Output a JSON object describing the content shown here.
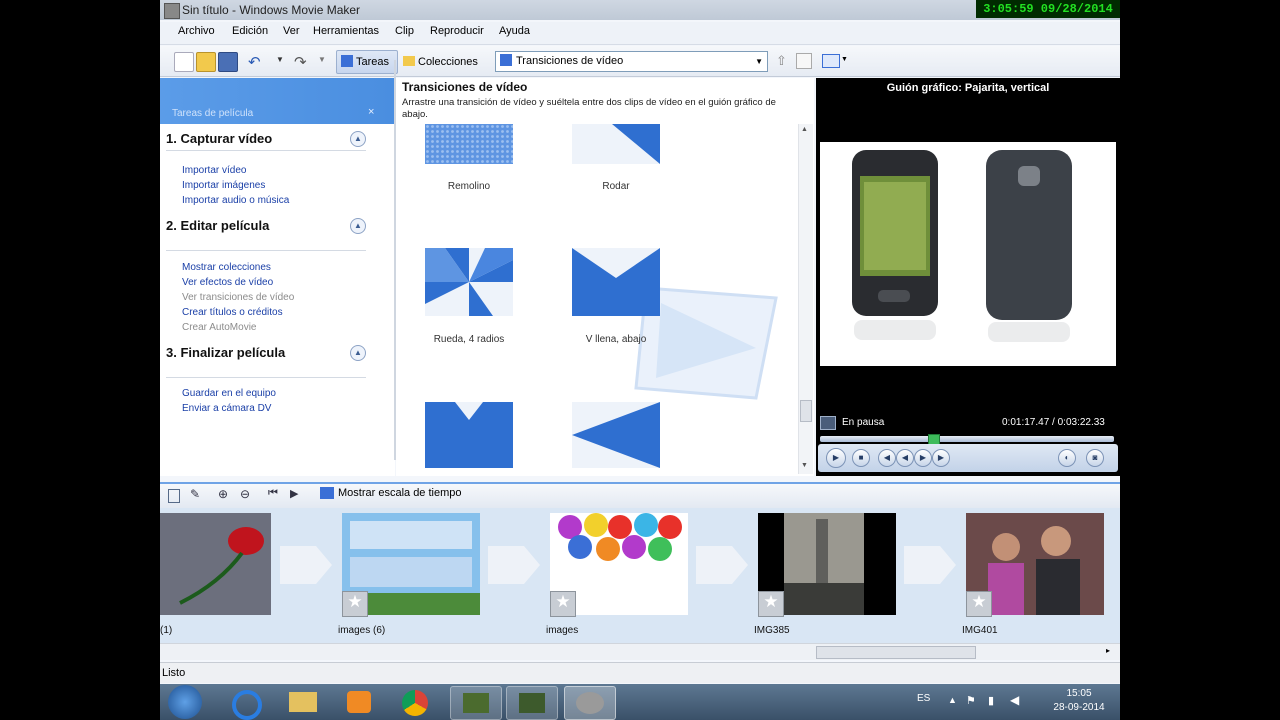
{
  "window": {
    "title": "Sin título - Windows Movie Maker"
  },
  "clock": "3:05:59  09/28/2014",
  "menu": [
    "Archivo",
    "Edición",
    "Ver",
    "Herramientas",
    "Clip",
    "Reproducir",
    "Ayuda"
  ],
  "toolbar": {
    "tasks_label": "Tareas",
    "collections_label": "Colecciones",
    "combo_value": "Transiciones de vídeo"
  },
  "tasks_pane": {
    "header": "Tareas de película",
    "close": "×",
    "sections": [
      {
        "title": "1. Capturar vídeo",
        "items": [
          {
            "label": "Importar vídeo",
            "disabled": false
          },
          {
            "label": "Importar imágenes",
            "disabled": false
          },
          {
            "label": "Importar audio o música",
            "disabled": false
          }
        ]
      },
      {
        "title": "2. Editar película",
        "items": [
          {
            "label": "Mostrar colecciones",
            "disabled": false
          },
          {
            "label": "Ver efectos de vídeo",
            "disabled": false
          },
          {
            "label": "Ver transiciones de vídeo",
            "disabled": true
          },
          {
            "label": "Crear títulos o créditos",
            "disabled": false
          },
          {
            "label": "Crear AutoMovie",
            "disabled": true
          }
        ]
      },
      {
        "title": "3. Finalizar película",
        "items": [
          {
            "label": "Guardar en el equipo",
            "disabled": false
          },
          {
            "label": "Enviar a cámara DV",
            "disabled": false
          }
        ]
      }
    ]
  },
  "transitions": {
    "title": "Transiciones de vídeo",
    "description": "Arrastre una transición de vídeo y suéltela entre dos clips de vídeo en el guión gráfico de abajo.",
    "items": [
      {
        "label": "Remolino"
      },
      {
        "label": "Rodar"
      },
      {
        "label": "Rueda, 4 radios"
      },
      {
        "label": "V llena, abajo"
      },
      {
        "label": ""
      },
      {
        "label": ""
      }
    ]
  },
  "preview": {
    "title": "Guión gráfico: Pajarita, vertical",
    "status": "En pausa",
    "time": "0:01:17.47 / 0:03:22.33",
    "progress": 0.38
  },
  "storyboard": {
    "show_timeline": "Mostrar escala de tiempo",
    "clips": [
      {
        "label": "(1)"
      },
      {
        "label": "images (6)"
      },
      {
        "label": "images"
      },
      {
        "label": "IMG385"
      },
      {
        "label": "IMG401"
      }
    ]
  },
  "status_bar": "Listo",
  "taskbar": {
    "lang": "ES",
    "time": "15:05",
    "date": "28-09-2014"
  },
  "colors": {
    "accent": "#4a8ee0",
    "transition_blue": "#2f6fd0",
    "link": "#1a3fa7"
  }
}
